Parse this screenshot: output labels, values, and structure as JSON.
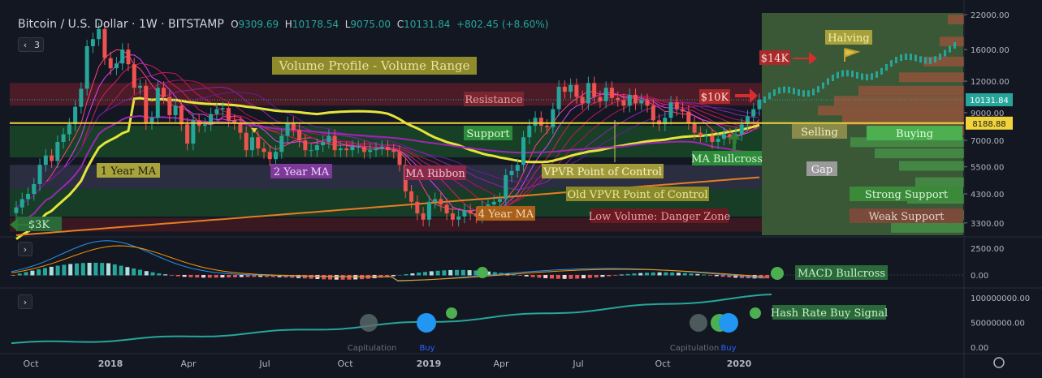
{
  "header": {
    "symbol": "Bitcoin / U.S. Dollar",
    "interval": "1W",
    "exchange": "BITSTAMP",
    "open_label": "O",
    "open": "9309.69",
    "high_label": "H",
    "high": "10178.54",
    "low_label": "L",
    "low": "9075.00",
    "close_label": "C",
    "close": "10131.84",
    "change": "+802.45 (+8.60%)"
  },
  "controls": {
    "collapse_main": "‹",
    "indicator_count": "3",
    "expand_macd": "›",
    "expand_hash": "›"
  },
  "colors": {
    "background": "#131722",
    "up": "#26a69a",
    "down": "#ef5350",
    "ma_1y": "#e4e43c",
    "ma_2y": "#9c27b0",
    "ma_4y": "#e57e21",
    "support_line": "#f0d43a"
  },
  "price_axis": {
    "ticks": [
      "22000.00",
      "16000.00",
      "12000.00",
      "9000.00",
      "7000.00",
      "5500.00",
      "4300.00",
      "3300.00"
    ],
    "last_price": "10131.84",
    "level_price": "8188.88"
  },
  "time_axis": {
    "ticks": [
      "Oct",
      "2018",
      "Apr",
      "Jul",
      "Oct",
      "2019",
      "Apr",
      "Jul",
      "Oct",
      "2020"
    ]
  },
  "annotations": {
    "title_box": "Volume Profile - Volume Range",
    "resistance": "Resistance",
    "support": "Support",
    "one_year_ma": "1 Year MA",
    "two_year_ma": "2 Year MA",
    "ma_ribbon": "MA Ribbon",
    "vpvr_poc": "VPVR Point of Control",
    "old_vpvr_poc": "Old VPVR Point of Control",
    "four_year_ma": "4 Year MA",
    "low_volume": "Low Volume: Danger Zone",
    "three_k": "$3K",
    "ten_k": "$10K",
    "fourteen_k": "$14K",
    "halving": "Halving",
    "selling": "Selling",
    "buying": "Buying",
    "ma_bullcross": "MA Bullcross",
    "gap": "Gap",
    "strong_support": "Strong Support",
    "weak_support": "Weak Support",
    "macd_bullcross": "MACD Bullcross",
    "hash_rate_signal": "Hash Rate Buy Signal",
    "hash_buy_1": "Buy",
    "hash_buy_2": "Buy",
    "hash_cap_1": "Capitulation",
    "hash_cap_2": "Capitulation"
  },
  "chart_data": [
    {
      "type": "candlestick",
      "title": "Bitcoin / U.S. Dollar",
      "yscale": "log",
      "ylim": [
        2950,
        23000
      ],
      "y_ticks": [
        22000,
        16000,
        12000,
        9000,
        7000,
        5500,
        4300,
        3300
      ],
      "x_ticks": [
        "Oct",
        "2018",
        "Apr",
        "Jul",
        "Oct",
        "2019",
        "Apr",
        "Jul",
        "Oct",
        "2020"
      ],
      "close_series_weekly_approx": [
        3800,
        4100,
        4300,
        4700,
        5600,
        6100,
        5800,
        6900,
        7400,
        8100,
        9500,
        11200,
        16500,
        17600,
        19300,
        14800,
        13500,
        14100,
        16000,
        14000,
        11300,
        11500,
        8200,
        8600,
        11300,
        10400,
        8800,
        9600,
        8100,
        6800,
        8400,
        8000,
        8100,
        8900,
        9300,
        9400,
        8400,
        8200,
        7500,
        6400,
        7200,
        6500,
        6300,
        5900,
        6300,
        7300,
        8200,
        7700,
        7000,
        6400,
        6400,
        6700,
        6900,
        7300,
        6400,
        6500,
        6400,
        6600,
        6600,
        6300,
        6400,
        6500,
        6600,
        6400,
        6300,
        5600,
        4400,
        4000,
        3600,
        3400,
        4000,
        4100,
        3900,
        3600,
        3400,
        3500,
        3700,
        3600,
        3500,
        3800,
        3900,
        4000,
        4100,
        5100,
        5300,
        5600,
        7200,
        8000,
        8600,
        8000,
        7900,
        9300,
        11400,
        10900,
        11600,
        10400,
        9800,
        11800,
        10400,
        10000,
        11300,
        10300,
        10100,
        9600,
        10600,
        9800,
        10100,
        9600,
        8400,
        8100,
        8600,
        9900,
        9300,
        9100,
        8200,
        7500,
        7300,
        7300,
        6900,
        7100,
        7400,
        7200,
        7400,
        8100,
        8700,
        9300,
        10131.84
      ],
      "moving_averages": [
        {
          "name": "1 Year MA"
        },
        {
          "name": "2 Year MA"
        },
        {
          "name": "4 Year MA"
        }
      ],
      "horizontal_levels": [
        8188.88,
        10131.84
      ]
    },
    {
      "type": "bar",
      "title": "MACD",
      "y_ticks": [
        2500,
        0
      ],
      "ylim": [
        -500,
        3000
      ]
    },
    {
      "type": "line",
      "title": "Hash Rate",
      "y_ticks": [
        100000000,
        50000000,
        0
      ],
      "y_tick_labels": [
        "100000000.00",
        "50000000.00",
        "0.00"
      ],
      "ylim": [
        0,
        115000000
      ]
    }
  ]
}
